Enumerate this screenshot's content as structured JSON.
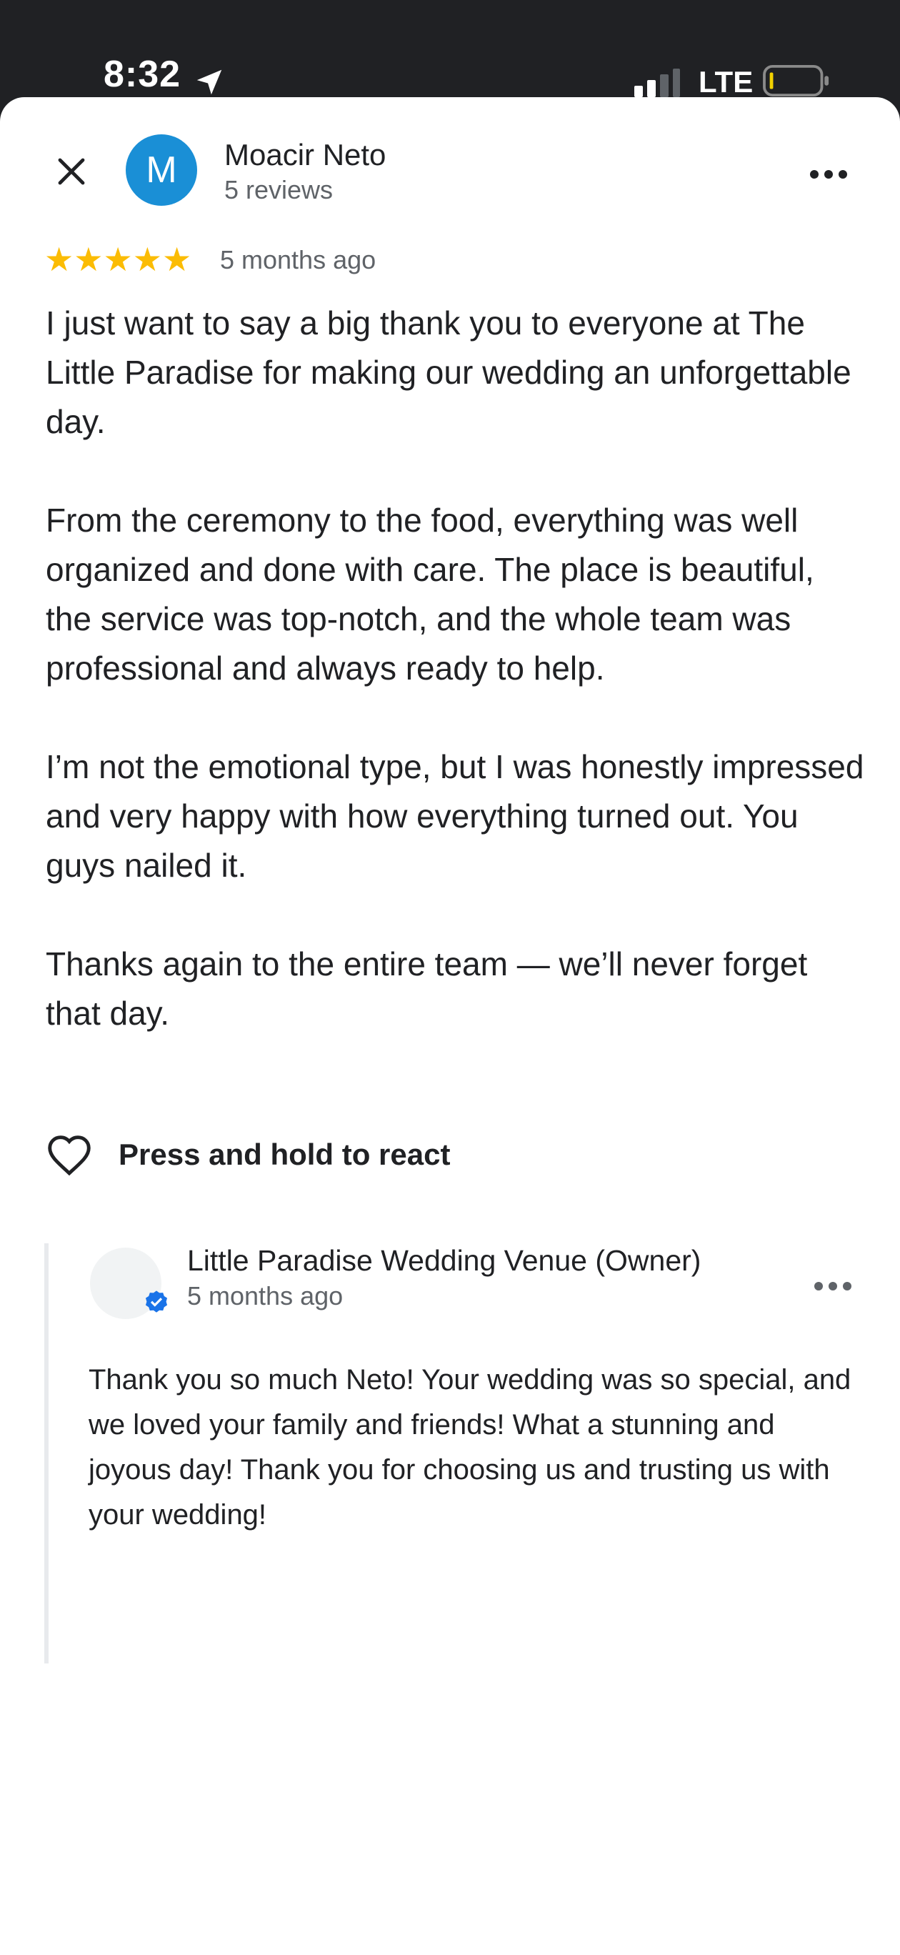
{
  "status_bar": {
    "time": "8:32",
    "network": "LTE"
  },
  "reviewer": {
    "avatar_initial": "M",
    "avatar_color": "#1a8fd6",
    "name": "Moacir Neto",
    "review_count": "5 reviews"
  },
  "review": {
    "rating": 5,
    "stars": "★★★★★",
    "date": "5 months ago",
    "paragraphs": [
      "I just want to say a big thank you to everyone at The Little Paradise for making our wedding an unforgettable day.",
      "From the ceremony to the food, everything was well organized and done with care. The place is beautiful, the service was top-notch, and the whole team was professional and always ready to help.",
      "I’m not the emotional type, but I was honestly impressed and very happy with how everything turned out. You guys nailed it.",
      "Thanks again to the entire team — we’ll never forget that day."
    ],
    "react_label": "Press and hold to react"
  },
  "owner_reply": {
    "name": "Little Paradise Wedding Venue (Owner)",
    "date": "5 months ago",
    "text": "Thank you so much Neto! Your wedding was so special, and we loved your family and friends! What a stunning and joyous day! Thank you for choosing us and trusting us with your wedding!"
  },
  "colors": {
    "star": "#fbbc04",
    "verified": "#1a73e8",
    "status_bar_bg": "#202124"
  },
  "icons": [
    "location-arrow-icon",
    "signal-icon",
    "battery-icon",
    "close-icon",
    "more-icon",
    "heart-icon",
    "verified-badge-icon"
  ]
}
